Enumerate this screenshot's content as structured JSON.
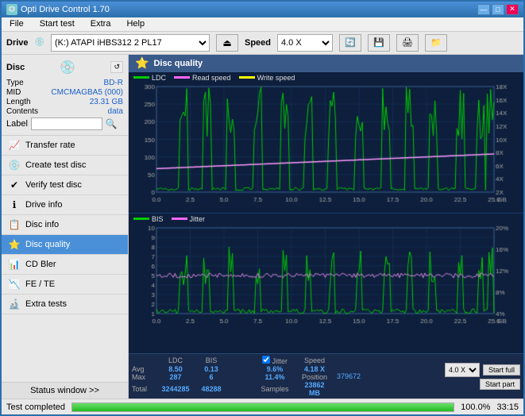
{
  "app": {
    "title": "Opti Drive Control 1.70",
    "icon": "💿"
  },
  "title_controls": {
    "minimize": "—",
    "maximize": "□",
    "close": "✕"
  },
  "menu": {
    "items": [
      "File",
      "Start test",
      "Extra",
      "Help"
    ]
  },
  "drive_bar": {
    "label": "Drive",
    "drive_value": "(K:) ATAPI iHBS312  2 PL17",
    "speed_label": "Speed",
    "speed_value": "4.0 X"
  },
  "disc": {
    "title": "Disc",
    "type_label": "Type",
    "type_value": "BD-R",
    "mid_label": "MID",
    "mid_value": "CMCMAGBA5 (000)",
    "length_label": "Length",
    "length_value": "23.31 GB",
    "contents_label": "Contents",
    "contents_value": "data",
    "label_label": "Label"
  },
  "nav": {
    "items": [
      {
        "id": "transfer-rate",
        "label": "Transfer rate",
        "icon": "📈"
      },
      {
        "id": "create-test-disc",
        "label": "Create test disc",
        "icon": "💿"
      },
      {
        "id": "verify-test-disc",
        "label": "Verify test disc",
        "icon": "✔"
      },
      {
        "id": "drive-info",
        "label": "Drive info",
        "icon": "ℹ"
      },
      {
        "id": "disc-info",
        "label": "Disc info",
        "icon": "📋"
      },
      {
        "id": "disc-quality",
        "label": "Disc quality",
        "icon": "⭐",
        "active": true
      },
      {
        "id": "cd-bler",
        "label": "CD Bler",
        "icon": "📊"
      },
      {
        "id": "fe-te",
        "label": "FE / TE",
        "icon": "📉"
      },
      {
        "id": "extra-tests",
        "label": "Extra tests",
        "icon": "🔬"
      }
    ],
    "status_window": "Status window >>"
  },
  "disc_quality": {
    "title": "Disc quality",
    "top_chart": {
      "legend": [
        {
          "label": "LDC",
          "color": "#00cc00"
        },
        {
          "label": "Read speed",
          "color": "#ff66ff"
        },
        {
          "label": "Write speed",
          "color": "#ffff00"
        }
      ],
      "y_max": 300,
      "y_right_max": 18,
      "x_max": 25,
      "x_labels": [
        "0.0",
        "2.5",
        "5.0",
        "7.5",
        "10.0",
        "12.5",
        "15.0",
        "17.5",
        "20.0",
        "22.5",
        "25.0"
      ],
      "y_labels_left": [
        "0",
        "50",
        "100",
        "150",
        "200",
        "250",
        "300"
      ],
      "y_labels_right": [
        "2X",
        "4X",
        "6X",
        "8X",
        "10X",
        "12X",
        "14X",
        "16X",
        "18X"
      ]
    },
    "bottom_chart": {
      "legend": [
        {
          "label": "BIS",
          "color": "#00cc00"
        },
        {
          "label": "Jitter",
          "color": "#ff66ff"
        }
      ],
      "y_max": 10,
      "y_right_max": 20,
      "x_max": 25,
      "x_labels": [
        "0.0",
        "2.5",
        "5.0",
        "7.5",
        "10.0",
        "12.5",
        "15.0",
        "17.5",
        "20.0",
        "22.5",
        "25.0"
      ],
      "y_labels_left": [
        "1",
        "2",
        "3",
        "4",
        "5",
        "6",
        "7",
        "8",
        "9",
        "10"
      ],
      "y_labels_right": [
        "4%",
        "8%",
        "12%",
        "16%",
        "20%"
      ]
    },
    "stats": {
      "ldc_label": "LDC",
      "bis_label": "BIS",
      "jitter_label": "Jitter",
      "speed_label": "Speed",
      "avg_label": "Avg",
      "max_label": "Max",
      "total_label": "Total",
      "avg_ldc": "8.50",
      "avg_bis": "0.13",
      "avg_jitter": "9.6%",
      "avg_speed": "4.18 X",
      "max_ldc": "287",
      "max_bis": "6",
      "max_jitter": "11.4%",
      "position_label": "Position",
      "position_value": "23862 MB",
      "total_ldc": "3244285",
      "total_bis": "48288",
      "samples_label": "Samples",
      "samples_value": "379672",
      "speed_select": "4.0 X",
      "start_full": "Start full",
      "start_part": "Start part",
      "jitter_checked": true
    }
  },
  "status_bar": {
    "status_text": "Test completed",
    "progress": 100,
    "time": "33:15"
  }
}
